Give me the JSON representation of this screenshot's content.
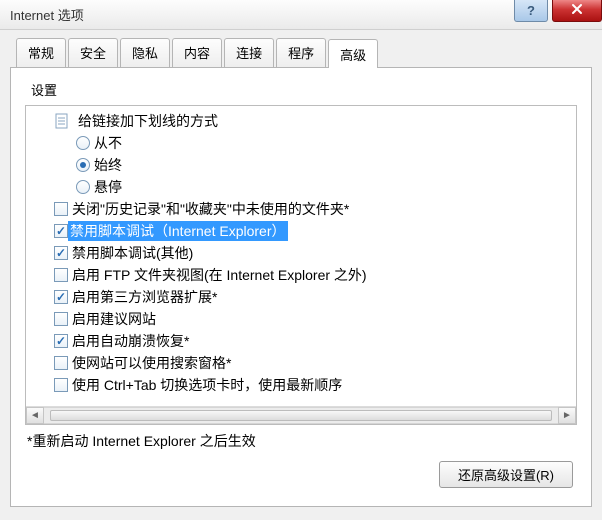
{
  "window": {
    "title": "Internet 选项",
    "help_glyph": "?"
  },
  "tabs": {
    "items": [
      {
        "label": "常规"
      },
      {
        "label": "安全"
      },
      {
        "label": "隐私"
      },
      {
        "label": "内容"
      },
      {
        "label": "连接"
      },
      {
        "label": "程序"
      },
      {
        "label": "高级"
      }
    ],
    "active_index": 6
  },
  "panel": {
    "group_label": "设置",
    "footnote": "*重新启动 Internet Explorer 之后生效",
    "restore_button": "还原高级设置(R)"
  },
  "tree": {
    "header": {
      "label": "给链接加下划线的方式"
    },
    "radios": [
      {
        "label": "从不",
        "checked": false
      },
      {
        "label": "始终",
        "checked": true
      },
      {
        "label": "悬停",
        "checked": false
      }
    ],
    "checks": [
      {
        "label": "关闭\"历史记录\"和\"收藏夹\"中未使用的文件夹*",
        "checked": false,
        "selected": false
      },
      {
        "label": "禁用脚本调试（Internet Explorer）",
        "checked": true,
        "selected": true
      },
      {
        "label": "禁用脚本调试(其他)",
        "checked": true,
        "selected": false
      },
      {
        "label": "启用 FTP 文件夹视图(在 Internet Explorer 之外)",
        "checked": false,
        "selected": false
      },
      {
        "label": "启用第三方浏览器扩展*",
        "checked": true,
        "selected": false
      },
      {
        "label": "启用建议网站",
        "checked": false,
        "selected": false
      },
      {
        "label": "启用自动崩溃恢复*",
        "checked": true,
        "selected": false
      },
      {
        "label": "使网站可以使用搜索窗格*",
        "checked": false,
        "selected": false
      },
      {
        "label": "使用 Ctrl+Tab 切换选项卡时，使用最新顺序",
        "checked": false,
        "selected": false
      }
    ]
  }
}
